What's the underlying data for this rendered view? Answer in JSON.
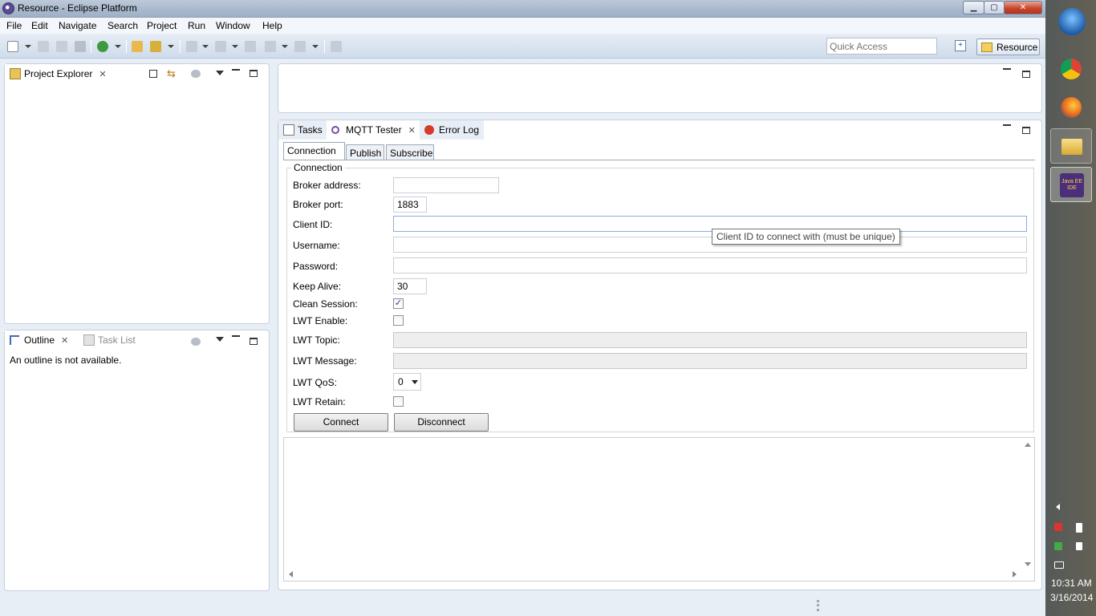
{
  "window": {
    "title": "Resource - Eclipse Platform",
    "min": "▁",
    "max": "▢",
    "close": "✕"
  },
  "menu": [
    "File",
    "Edit",
    "Navigate",
    "Search",
    "Project",
    "Run",
    "Window",
    "Help"
  ],
  "toolbar": {
    "quick_access_placeholder": "Quick Access",
    "perspective": "Resource"
  },
  "project_explorer": {
    "tab": "Project Explorer"
  },
  "outline": {
    "tab_outline": "Outline",
    "tab_tasklist": "Task List",
    "message": "An outline is not available."
  },
  "bottom_tabs": {
    "tasks": "Tasks",
    "mqtt": "MQTT Tester",
    "errorlog": "Error Log"
  },
  "mqtt": {
    "subtabs": {
      "connection": "Connection",
      "publish": "Publish",
      "subscribe": "Subscribe"
    },
    "group_title": "Connection",
    "labels": {
      "broker_address": "Broker address:",
      "broker_port": "Broker port:",
      "client_id": "Client ID:",
      "username": "Username:",
      "password": "Password:",
      "keep_alive": "Keep Alive:",
      "clean_session": "Clean Session:",
      "lwt_enable": "LWT Enable:",
      "lwt_topic": "LWT Topic:",
      "lwt_message": "LWT Message:",
      "lwt_qos": "LWT QoS:",
      "lwt_retain": "LWT Retain:"
    },
    "values": {
      "broker_address": "",
      "broker_port": "1883",
      "client_id": "",
      "username": "",
      "password": "",
      "keep_alive": "30",
      "lwt_topic": "",
      "lwt_message": "",
      "lwt_qos": "0"
    },
    "checks": {
      "clean_session": "✓",
      "lwt_enable": "",
      "lwt_retain": ""
    },
    "buttons": {
      "connect": "Connect",
      "disconnect": "Disconnect"
    },
    "tooltip": "Client ID to connect with (must be unique)"
  },
  "clock": {
    "time": "10:31 AM",
    "date": "3/16/2014"
  },
  "taskbar_java": "Java EE IDE"
}
